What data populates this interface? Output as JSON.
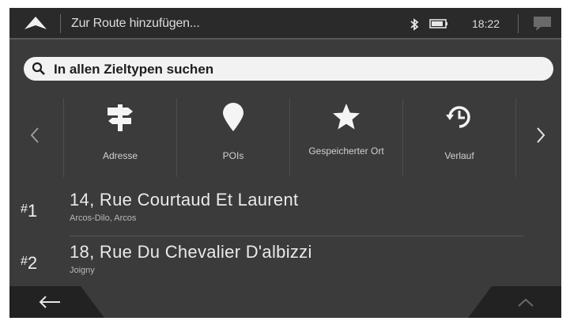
{
  "header": {
    "title": "Zur Route hinzufügen...",
    "time": "18:22"
  },
  "search": {
    "label": "In allen Zieltypen suchen"
  },
  "categories": [
    {
      "label": "Adresse",
      "icon": "signpost-icon"
    },
    {
      "label": "POIs",
      "icon": "location-pin-icon"
    },
    {
      "label": "Gespeicherter Ort",
      "icon": "star-icon"
    },
    {
      "label": "Verlauf",
      "icon": "history-clock-icon"
    }
  ],
  "recent": [
    {
      "rank": "1",
      "street": "14, Rue Courtaud Et Laurent",
      "city": "Arcos-Dilo, Arcos"
    },
    {
      "rank": "2",
      "street": "18, Rue Du Chevalier D'albizzi",
      "city": "Joigny"
    }
  ],
  "colors": {
    "background": "#3b3b3b",
    "header": "#2a2a2a",
    "footer": "#222222",
    "search_field": "#f2f2f2",
    "text": "#e8e8e8"
  }
}
